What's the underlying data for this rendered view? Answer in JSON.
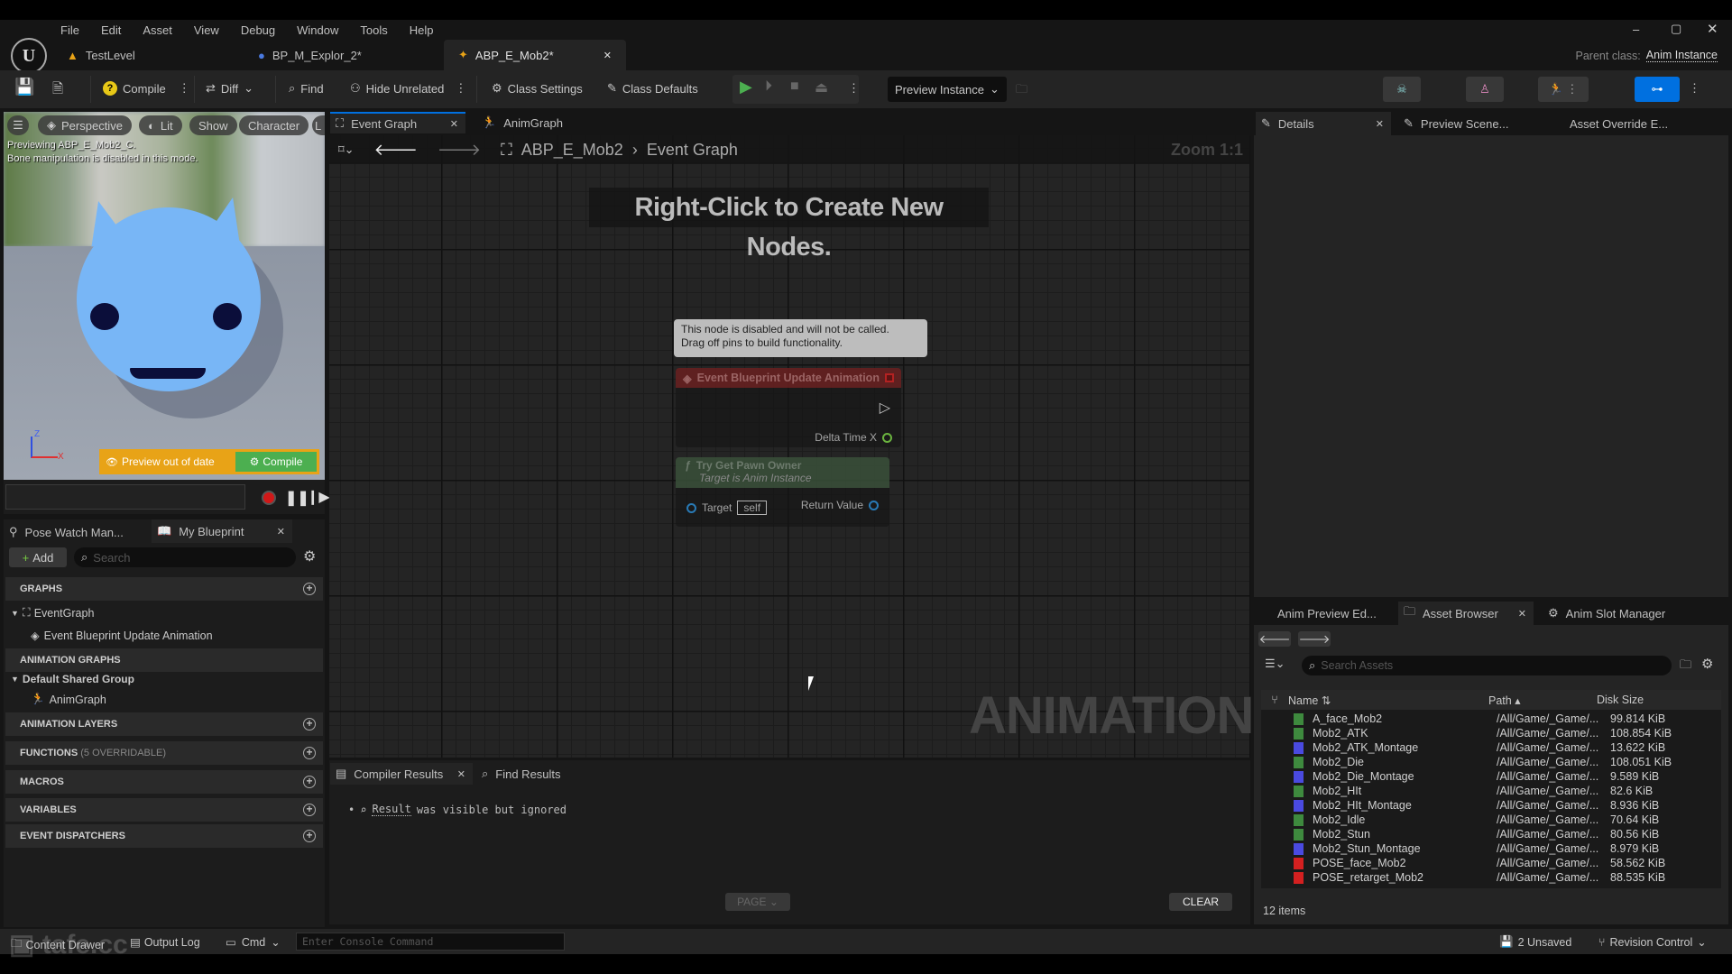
{
  "menu": [
    "File",
    "Edit",
    "Asset",
    "View",
    "Debug",
    "Window",
    "Tools",
    "Help"
  ],
  "doc_tabs": [
    {
      "label": "TestLevel"
    },
    {
      "label": "BP_M_Explor_2*"
    },
    {
      "label": "ABP_E_Mob2*",
      "active": true
    }
  ],
  "parent_class": {
    "label": "Parent class:",
    "value": "Anim Instance"
  },
  "toolbar": {
    "compile": "Compile",
    "diff": "Diff",
    "find": "Find",
    "hide_unrelated": "Hide Unrelated",
    "class_settings": "Class Settings",
    "class_defaults": "Class Defaults",
    "preview_instance": "Preview Instance"
  },
  "viewport": {
    "buttons": [
      "Perspective",
      "Lit",
      "Show",
      "Character",
      "L"
    ],
    "info_line1": "Previewing ABP_E_Mob2_C.",
    "info_line2": "Bone manipulation is disabled in this mode.",
    "preview_out_of_date": "Preview out of date",
    "compile": "Compile",
    "axis_z": "Z",
    "axis_x": "X"
  },
  "my_blueprint": {
    "tabs": [
      "Pose Watch Man...",
      "My Blueprint"
    ],
    "add": "Add",
    "search_placeholder": "Search",
    "graphs": "GRAPHS",
    "event_graph": "EventGraph",
    "event_update": "Event Blueprint Update Animation",
    "animation_graphs": "ANIMATION GRAPHS",
    "default_group": "Default Shared Group",
    "anim_graph": "AnimGraph",
    "animation_layers": "ANIMATION LAYERS",
    "functions": "FUNCTIONS",
    "functions_note": "(5 OVERRIDABLE)",
    "macros": "MACROS",
    "variables": "VARIABLES",
    "event_dispatchers": "EVENT DISPATCHERS"
  },
  "graph": {
    "tabs": [
      "Event Graph",
      "AnimGraph"
    ],
    "breadcrumb": [
      "ABP_E_Mob2",
      "Event Graph"
    ],
    "zoom": "Zoom 1:1",
    "hint": "Right-Click to Create New Nodes.",
    "watermark": "ANIMATION",
    "tooltip_line1": "This node is disabled and will not be called.",
    "tooltip_line2": "Drag off pins to build functionality.",
    "event_node": {
      "title": "Event Blueprint Update Animation",
      "pin": "Delta Time X"
    },
    "pawn_node": {
      "title": "Try Get Pawn Owner",
      "subtitle": "Target is Anim Instance",
      "target": "Target",
      "target_value": "self",
      "return": "Return Value"
    }
  },
  "compiler": {
    "tabs": [
      "Compiler Results",
      "Find Results"
    ],
    "result_link": "Result",
    "result_text": "was visible but ignored",
    "page": "PAGE",
    "clear": "CLEAR"
  },
  "details": {
    "tabs": [
      "Details",
      "Preview Scene...",
      "Asset Override E..."
    ]
  },
  "asset_browser": {
    "tabs": [
      "Anim Preview Ed...",
      "Asset Browser",
      "Anim Slot Manager"
    ],
    "search_placeholder": "Search Assets",
    "columns": [
      "Name",
      "Path",
      "Disk Size"
    ],
    "items": [
      {
        "name": "A_face_Mob2",
        "path": "/All/Game/_Game/...",
        "size": "99.814 KiB",
        "type": "anim",
        "color": "#3e8a3e"
      },
      {
        "name": "Mob2_ATK",
        "path": "/All/Game/_Game/...",
        "size": "108.854 KiB",
        "type": "anim",
        "color": "#3e8a3e"
      },
      {
        "name": "Mob2_ATK_Montage",
        "path": "/All/Game/_Game/...",
        "size": "13.622 KiB",
        "type": "montage",
        "color": "#4a4ae0"
      },
      {
        "name": "Mob2_Die",
        "path": "/All/Game/_Game/...",
        "size": "108.051 KiB",
        "type": "anim",
        "color": "#3e8a3e"
      },
      {
        "name": "Mob2_Die_Montage",
        "path": "/All/Game/_Game/...",
        "size": "9.589 KiB",
        "type": "montage",
        "color": "#4a4ae0"
      },
      {
        "name": "Mob2_HIt",
        "path": "/All/Game/_Game/...",
        "size": "82.6 KiB",
        "type": "anim",
        "color": "#3e8a3e"
      },
      {
        "name": "Mob2_HIt_Montage",
        "path": "/All/Game/_Game/...",
        "size": "8.936 KiB",
        "type": "montage",
        "color": "#4a4ae0"
      },
      {
        "name": "Mob2_Idle",
        "path": "/All/Game/_Game/...",
        "size": "70.64 KiB",
        "type": "anim",
        "color": "#3e8a3e"
      },
      {
        "name": "Mob2_Stun",
        "path": "/All/Game/_Game/...",
        "size": "80.56 KiB",
        "type": "anim",
        "color": "#3e8a3e"
      },
      {
        "name": "Mob2_Stun_Montage",
        "path": "/All/Game/_Game/...",
        "size": "8.979 KiB",
        "type": "montage",
        "color": "#4a4ae0"
      },
      {
        "name": "POSE_face_Mob2",
        "path": "/All/Game/_Game/...",
        "size": "58.562 KiB",
        "type": "pose",
        "color": "#d42020"
      },
      {
        "name": "POSE_retarget_Mob2",
        "path": "/All/Game/_Game/...",
        "size": "88.535 KiB",
        "type": "pose",
        "color": "#d42020"
      }
    ],
    "count": "12 items"
  },
  "status_bar": {
    "content_drawer": "Content Drawer",
    "output_log": "Output Log",
    "cmd": "Cmd",
    "console_placeholder": "Enter Console Command",
    "unsaved": "2 Unsaved",
    "revision_control": "Revision Control"
  },
  "watermark_logo": "tafe.cc",
  "colors": {
    "accent": "#0070e0",
    "warning": "#e8a317",
    "compile_green": "#4caf50",
    "event_node": "#8b2020",
    "pure_node": "#3c5a3c"
  }
}
